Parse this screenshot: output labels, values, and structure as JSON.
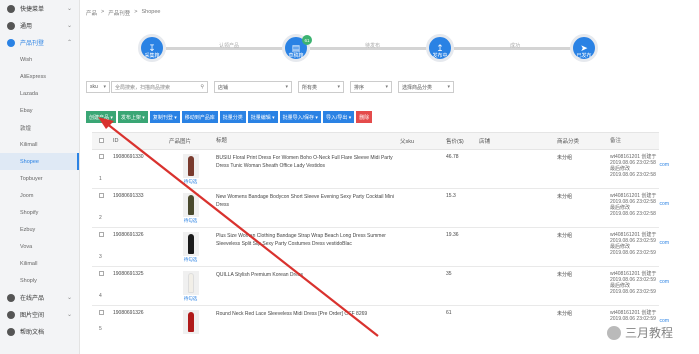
{
  "sidebar": {
    "groups": [
      {
        "label": "快捷菜单",
        "icon": "speedometer-icon"
      },
      {
        "label": "通用",
        "icon": "gear-icon"
      },
      {
        "label": "产品刊登",
        "icon": "product-icon"
      }
    ],
    "items": [
      {
        "label": "Wish"
      },
      {
        "label": "AliExpress"
      },
      {
        "label": "Lazada"
      },
      {
        "label": "Ebay"
      },
      {
        "label": "敦煌"
      },
      {
        "label": "Kilimall"
      },
      {
        "label": "Shopee"
      },
      {
        "label": "Topbuyer"
      },
      {
        "label": "Joom"
      },
      {
        "label": "Shopify"
      },
      {
        "label": "Ezbuy"
      },
      {
        "label": "Vova"
      },
      {
        "label": "Kilimall"
      },
      {
        "label": "Shoply"
      }
    ],
    "bottom_groups": [
      {
        "label": "在线产品",
        "icon": "box-icon"
      },
      {
        "label": "图片空间",
        "icon": "image-icon"
      },
      {
        "label": "帮助文档",
        "icon": "help-icon"
      }
    ]
  },
  "breadcrumb": [
    "产品",
    "产品刊登",
    "Shopee"
  ],
  "steps": {
    "step1": "采集箱",
    "line1": "认领产品",
    "step2": "草稿箱",
    "step2_badge": "61",
    "line2": "待发布",
    "step3": "发布中",
    "line3": "成功",
    "step4": "已发布"
  },
  "filters": {
    "site": "sku",
    "search_placeholder": "全局搜索，扫描商品搜索",
    "store": "店铺",
    "category": "所有类",
    "sort": "排序",
    "product_category": "选择商品分类"
  },
  "toolbar": {
    "create": "创建产品 ▾",
    "publish": "发布上架 ▾",
    "copy": "复制刊登 ▾",
    "move": "移动到产品库",
    "batch_category": "批量分类",
    "batch_edit": "批量编辑 ▾",
    "batch_save": "批量导入/保存 ▾",
    "import_export": "导入/导出 ▾",
    "delete": "删除"
  },
  "table": {
    "headers": {
      "id": "ID",
      "image": "产品图片",
      "title": "标题",
      "sku": "父sku",
      "price": "售价($)",
      "stock": "店铺",
      "category": "商品分类",
      "time": "备注"
    },
    "rows": [
      {
        "num": "1",
        "id": "19080691330",
        "title": "BUSIU Floral Print Dress For Women Boho O-Neck Full Flare Sleeve Midi Party Dress Tunic Woman Sheath Office Lady Vestidos",
        "price": "46.78",
        "category": "未分组",
        "created": "wt408161201 创建于",
        "t1": "2019.08.06 23:02:58",
        "mod": "最后修改",
        "t2": "2019.08.06 23:02:58",
        "com": "com",
        "thumb_link": "待勾选",
        "color": "#7a3b2e"
      },
      {
        "num": "2",
        "id": "19080691333",
        "title": "New Womens Bandage Bodycon Short Sleeve Evening Sexy Party Cocktail Mini Dress",
        "price": "15.3",
        "category": "未分组",
        "created": "wt408161201 创建于",
        "t1": "2019.08.06 23:02:58",
        "mod": "最后修改",
        "t2": "2019.08.06 23:02:58",
        "com": "com",
        "thumb_link": "待勾选",
        "color": "#4a4a2e"
      },
      {
        "num": "3",
        "id": "19080691326",
        "title": "Plus Size Women Clothing Bandage Strap Wrap Beach Long Dress Summer Sleeveless Split Slip Sexy Party Costumes Dress vestidoBlac",
        "price": "19.36",
        "category": "未分组",
        "created": "wt408161201 创建于",
        "t1": "2019.08.06 23:02:59",
        "mod": "最后修改",
        "t2": "2019.08.06 23:02:59",
        "com": "com",
        "thumb_link": "待勾选",
        "color": "#1a1a1a"
      },
      {
        "num": "4",
        "id": "19080691325",
        "title": "QUILLA Stylish Premium Korean Dress",
        "price": "35",
        "category": "未分组",
        "created": "wt408161201 创建于",
        "t1": "2019.08.06 23:02:59",
        "mod": "最后修改",
        "t2": "2019.08.06 23:02:59",
        "com": "com",
        "thumb_link": "待勾选",
        "color": "#f2efe8"
      },
      {
        "num": "5",
        "id": "19080691326",
        "title": "Round Neck Red Lace Sleeveless Midi Dress [Pre Order] CCF 8269",
        "price": "61",
        "category": "未分组",
        "created": "wt408161201 创建于",
        "t1": "2019.08.06 23:02:59",
        "mod": "",
        "t2": "",
        "com": "com",
        "thumb_link": "",
        "color": "#b01a1a"
      }
    ]
  },
  "watermark": "三月教程",
  "colors": {
    "accent": "#2a82e4",
    "green": "#3aa675",
    "danger": "#e44b4b",
    "annotation_arrow": "#d9322e"
  }
}
